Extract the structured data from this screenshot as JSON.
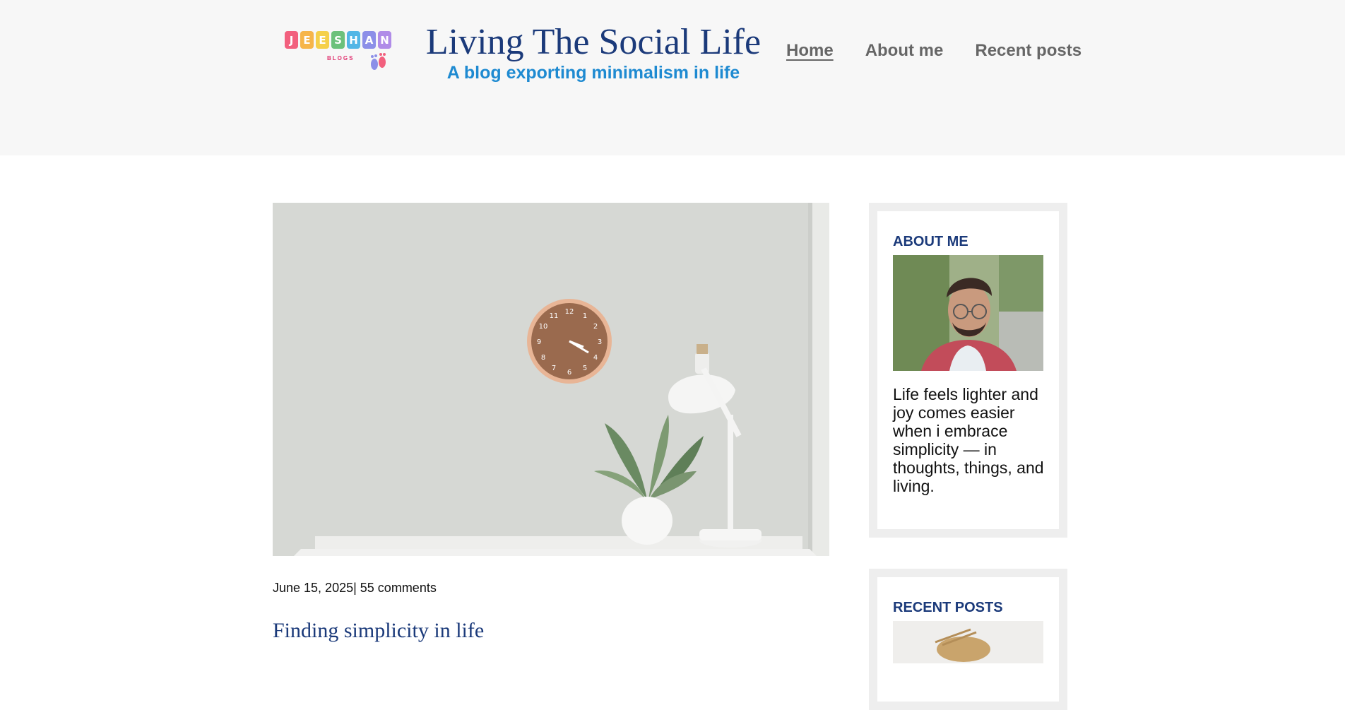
{
  "logo": {
    "letters": [
      "J",
      "E",
      "E",
      "S",
      "H",
      "A",
      "N"
    ],
    "letter_colors": [
      "#f2607e",
      "#f6b54a",
      "#f5d04a",
      "#6cc17b",
      "#52b6e6",
      "#8c8fe8",
      "#b08ce8"
    ],
    "sub": "BLOGS"
  },
  "site": {
    "title": "Living The Social Life",
    "tagline": "A blog exporting minimalism in life"
  },
  "nav": [
    {
      "label": "Home",
      "active": true
    },
    {
      "label": "About me",
      "active": false
    },
    {
      "label": "Recent posts",
      "active": false
    }
  ],
  "post": {
    "date": "June 15, 2025",
    "comments": "| 55 comments",
    "title": "Finding simplicity in life"
  },
  "sidebar": {
    "about": {
      "heading": "ABOUT ME",
      "text": "Life feels lighter and joy comes easier when i embrace simplicity — in thoughts, things, and living."
    },
    "recent": {
      "heading": "RECENT POSTS"
    }
  },
  "colors": {
    "title": "#1b3a7a",
    "tagline": "#1e8ad1",
    "nav": "#666666",
    "header_bg": "#f7f7f7",
    "widget_border": "#eeeeee"
  }
}
